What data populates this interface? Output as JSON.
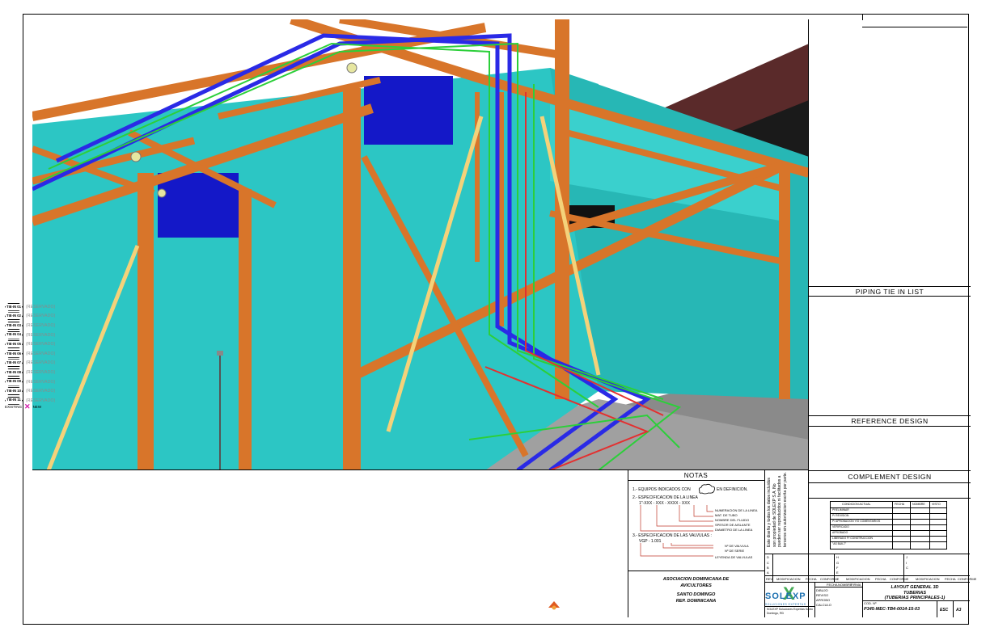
{
  "right_panel": {
    "piping_tie_in_title": "PIPING TIE IN LIST",
    "tie_ins": [
      {
        "tag": "TIE-IN 01",
        "status": "(RESERVADO)"
      },
      {
        "tag": "TIE-IN 02",
        "status": "(RESERVADO)"
      },
      {
        "tag": "TIE-IN 03",
        "status": "(RESERVADO)"
      },
      {
        "tag": "TIE-IN 04",
        "status": "(RESERVADO)"
      },
      {
        "tag": "TIE-IN 05",
        "status": "(RESERVADO)"
      },
      {
        "tag": "TIE-IN 06",
        "status": "(RESERVADO)"
      },
      {
        "tag": "TIE-IN 07",
        "status": "(RESERVADO)"
      },
      {
        "tag": "TIE-IN 08",
        "status": "(RESERVADO)"
      },
      {
        "tag": "TIE-IN 09",
        "status": "(RESERVADO)"
      },
      {
        "tag": "TIE-IN 10",
        "status": "(RESERVADO)"
      },
      {
        "tag": "TIE-IN 11",
        "status": "(RESERVADO)"
      }
    ],
    "tie_in_legend_left": "EXISTING",
    "tie_in_legend_right": "NEW",
    "reference_title": "REFERENCE DESIGN",
    "complement_title": "COMPLEMENT DESIGN",
    "conditions": {
      "header": [
        "CONDICION ACTUAL",
        "FECHA",
        "NOMBRE",
        "VISTO"
      ],
      "rows": [
        "PRELIMINAR",
        "P/ REVISION",
        "P/ APROBACION Y/O COMENTARIOS",
        "VERIFICADO",
        "APROBADO",
        "LIBERADO P/ CONSTRUCCION",
        "\"AS BUILT\""
      ]
    }
  },
  "notes": {
    "title": "NOTAS",
    "n1": "1.- EQUIPOS INDICADOS CON",
    "n1_tail": "EN DEFINICION.",
    "n2": "2.- ESPECIFICACION DE LA LINEA",
    "n2_code": "1\"-XXX - XXX - XXXX - XXX",
    "n2_labels": [
      "NUMERACION DE LA LINEA",
      "MAT. DE TUBO",
      "NOMBRE DEL FLUIDO",
      "SPESOR DE AISLANTE",
      "DIAMETRO DE LA LINEA"
    ],
    "n3": "3.- ESPECIFICACION DE LAS VALVULAS :",
    "n3_code": "VGP - 1.001",
    "n3_labels": [
      "Nº DE VALVULA",
      "Nº DE SERIE",
      "LEYENDA DE VALVULAS"
    ]
  },
  "client": {
    "line1": "ASOCIACION DOMINICANA DE",
    "line2": "AVICULTORES",
    "line3": "SANTO DOMINGO",
    "line4": "REP. DOMINICANA"
  },
  "notice": "Este diseño y todos los datos incluidos son propiedad de SOLEXP S.A. No pueden ser reproducidos ni facilitados a terceros sin autorizacion escrita por parte.",
  "revision_letters_left": [
    "D",
    "C",
    "B",
    "A"
  ],
  "revision_letters_mid": [
    "H",
    "G",
    "F",
    "E"
  ],
  "revision_letters_right": [
    "J",
    "I",
    "C"
  ],
  "revision_header": [
    "REV",
    "MODIFICACION",
    "FECHA",
    "CONFORME"
  ],
  "signature_labels": [
    "DIBUJO",
    "REVISO",
    "APROBO",
    "CALCULO"
  ],
  "signature_header": [
    "FECHA",
    "NOMBRE",
    "FIRMA"
  ],
  "title": {
    "line1": "LAYOUT GENERAL 3D",
    "line2": "TUBERIAS",
    "line3": "(TUBERIAS PRINCIPALES-1)",
    "doc_label": "COD. Nº",
    "doc_number": "P345-MEC-TB4-0014-15-03",
    "rev": "A3",
    "scale_label": "ESC"
  },
  "logo": {
    "text": "SOLEXP",
    "sub": "SOLUCIONES EXPERTAS"
  },
  "company_addr": "SOLEXP Soluciones Expertas Santo Domingo, RD"
}
